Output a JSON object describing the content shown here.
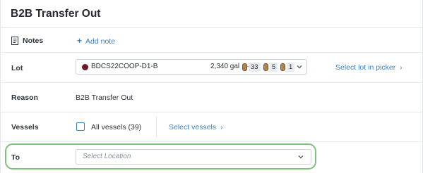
{
  "header": {
    "title": "B2B Transfer Out"
  },
  "notes": {
    "label": "Notes",
    "add_label": "Add note",
    "add_prefix": "+"
  },
  "lot": {
    "label": "Lot",
    "lot_code": "BDCS22COOP-D1-B",
    "volume": "2,340 gal",
    "separator": "–",
    "counts": [
      "33",
      "5",
      "1"
    ],
    "picker_link": "Select lot in picker",
    "link_arrow": "›",
    "lot_color": "#6b1b26"
  },
  "reason": {
    "label": "Reason",
    "value": "B2B Transfer Out"
  },
  "vessels": {
    "label": "Vessels",
    "all_label": "All vessels (39)",
    "all_checked": false,
    "select_link": "Select vessels",
    "link_arrow": "›"
  },
  "to": {
    "label": "To",
    "placeholder": "Select Location",
    "highlight_color": "#7cc27b"
  },
  "colors": {
    "accent": "#3b82c4",
    "border": "#cdd2d8",
    "text": "#2c3138"
  }
}
